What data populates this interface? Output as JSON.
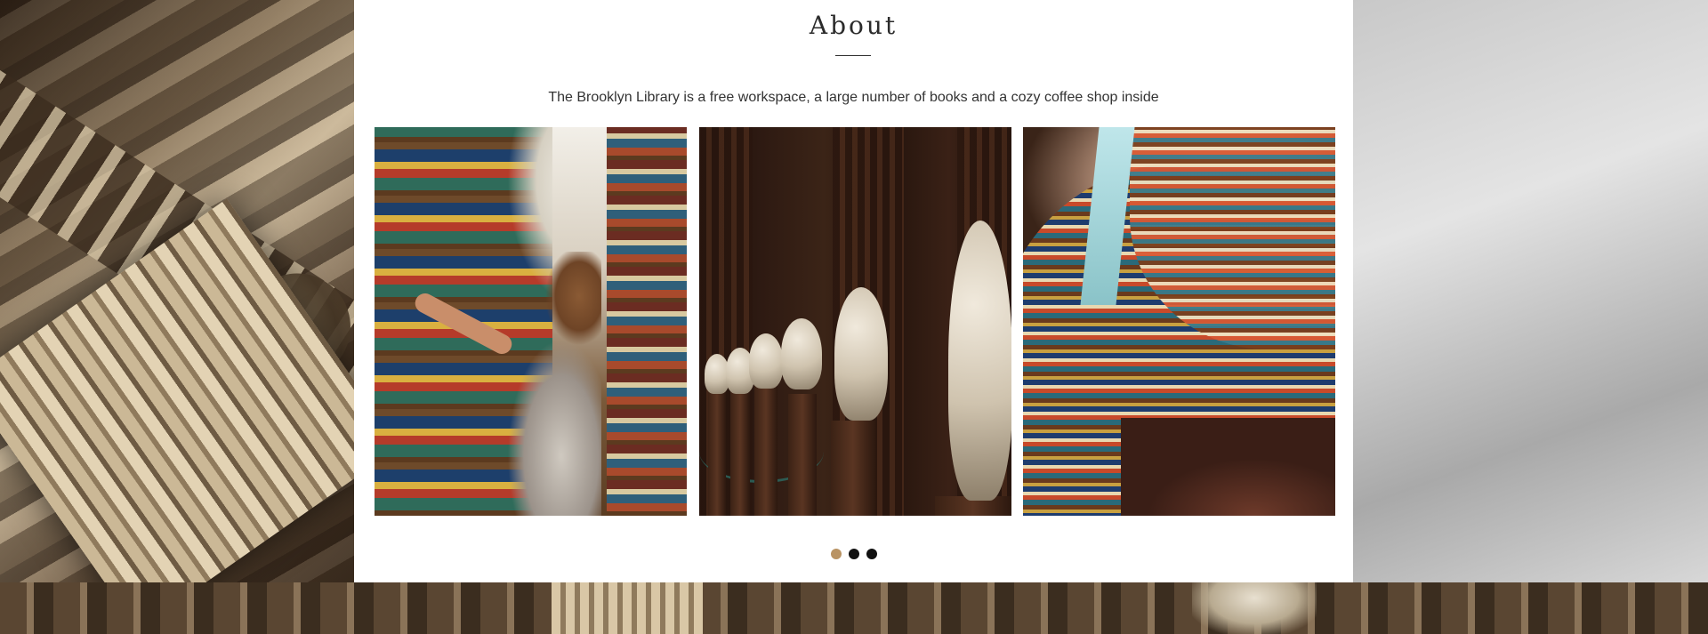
{
  "about": {
    "title": "About",
    "description": "The Brooklyn Library is a free workspace, a large number of books and a cozy coffee shop inside"
  },
  "gallery": {
    "photos": [
      {
        "subject": "woman browsing library shelves"
      },
      {
        "subject": "row of marble busts"
      },
      {
        "subject": "curved library bookshelves"
      }
    ]
  },
  "carousel": {
    "slide_count": 3,
    "active_index": 0
  },
  "colors": {
    "accent": "#b99363",
    "dot_inactive": "#111111",
    "card_background": "#ffffff",
    "text": "#333333"
  }
}
